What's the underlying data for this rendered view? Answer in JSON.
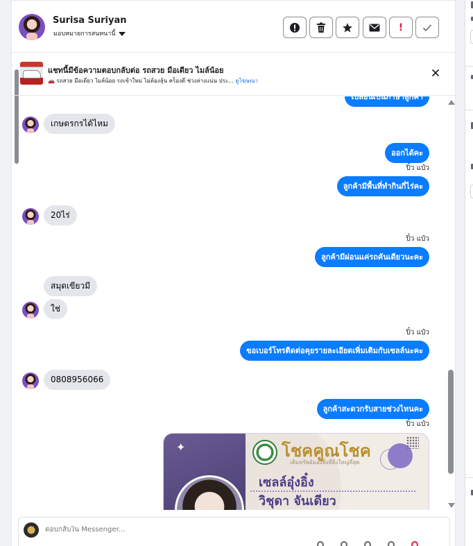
{
  "header": {
    "name": "Surisa Suriyan",
    "subtitle": "มอบหมายการสนทนานี้",
    "toolbar": [
      {
        "icon": "alert-circle-icon"
      },
      {
        "icon": "trash-icon"
      },
      {
        "icon": "star-icon"
      },
      {
        "icon": "mail-icon"
      },
      {
        "icon": "exclamation-icon",
        "label": "!"
      },
      {
        "icon": "check-icon"
      }
    ]
  },
  "ad": {
    "title": "แชทนี้มีข้อความตอบกลับต่อ รถสวย มือเดียว ไมล์น้อย",
    "snippet": "🚗 รถสวย มือเดียว ไมล์น้อย รถเข้าใหม่ ไม่ต้องลุ้น คร็องดี ช่วงล่างแน่น ประ...",
    "link": "ดูโฆษณา"
  },
  "messages": {
    "partial_top": "เปลี่ยนเป็นภาษาลูกค้า",
    "m1": "เกษตรกรได้ไหม",
    "m2": "ออกได้คะ",
    "seen1": "ปิ๋ว แป๋ว",
    "m3": "ลูกค้ามีพื้นที่ทำกินกี่ไร่คะ",
    "m4": "20ไร่",
    "seen2": "ปิ๋ว แป๋ว",
    "m5": "ลูกค้ามีผ่อนแค่รถคันเดียวนะคะ",
    "m6": "สมุดเขียวมี",
    "m7": "ใช่",
    "seen3": "ปิ๋ว แป๋ว",
    "m8": "ขอเบอร์โทรติดต่อคุยรายละเอียดเพิ่มเติมกับเซลล์นะคะ",
    "m9": "0808956066",
    "m10": "ลูกค้าสะดวกรับสายช่วงไหนคะ",
    "seen4": "ปิ๋ว แป๋ว"
  },
  "card": {
    "brand": "โชคคูณโชค",
    "tagline": "เติมทรัพย์มองสิ่งที่ยิ่งใหญ่ที่สุด",
    "name_line1": "เซลล์อุ๋งอิ๋ง",
    "name_line2": "วิชุดา จันเดียว"
  },
  "composer": {
    "placeholder": "ตอบกลับใน Messenger..."
  },
  "colors": {
    "outgoing_bubble": "#0a7cff",
    "incoming_bubble": "#e4e6eb",
    "card_purple": "#4f3d86",
    "card_gold": "#b9902f"
  }
}
